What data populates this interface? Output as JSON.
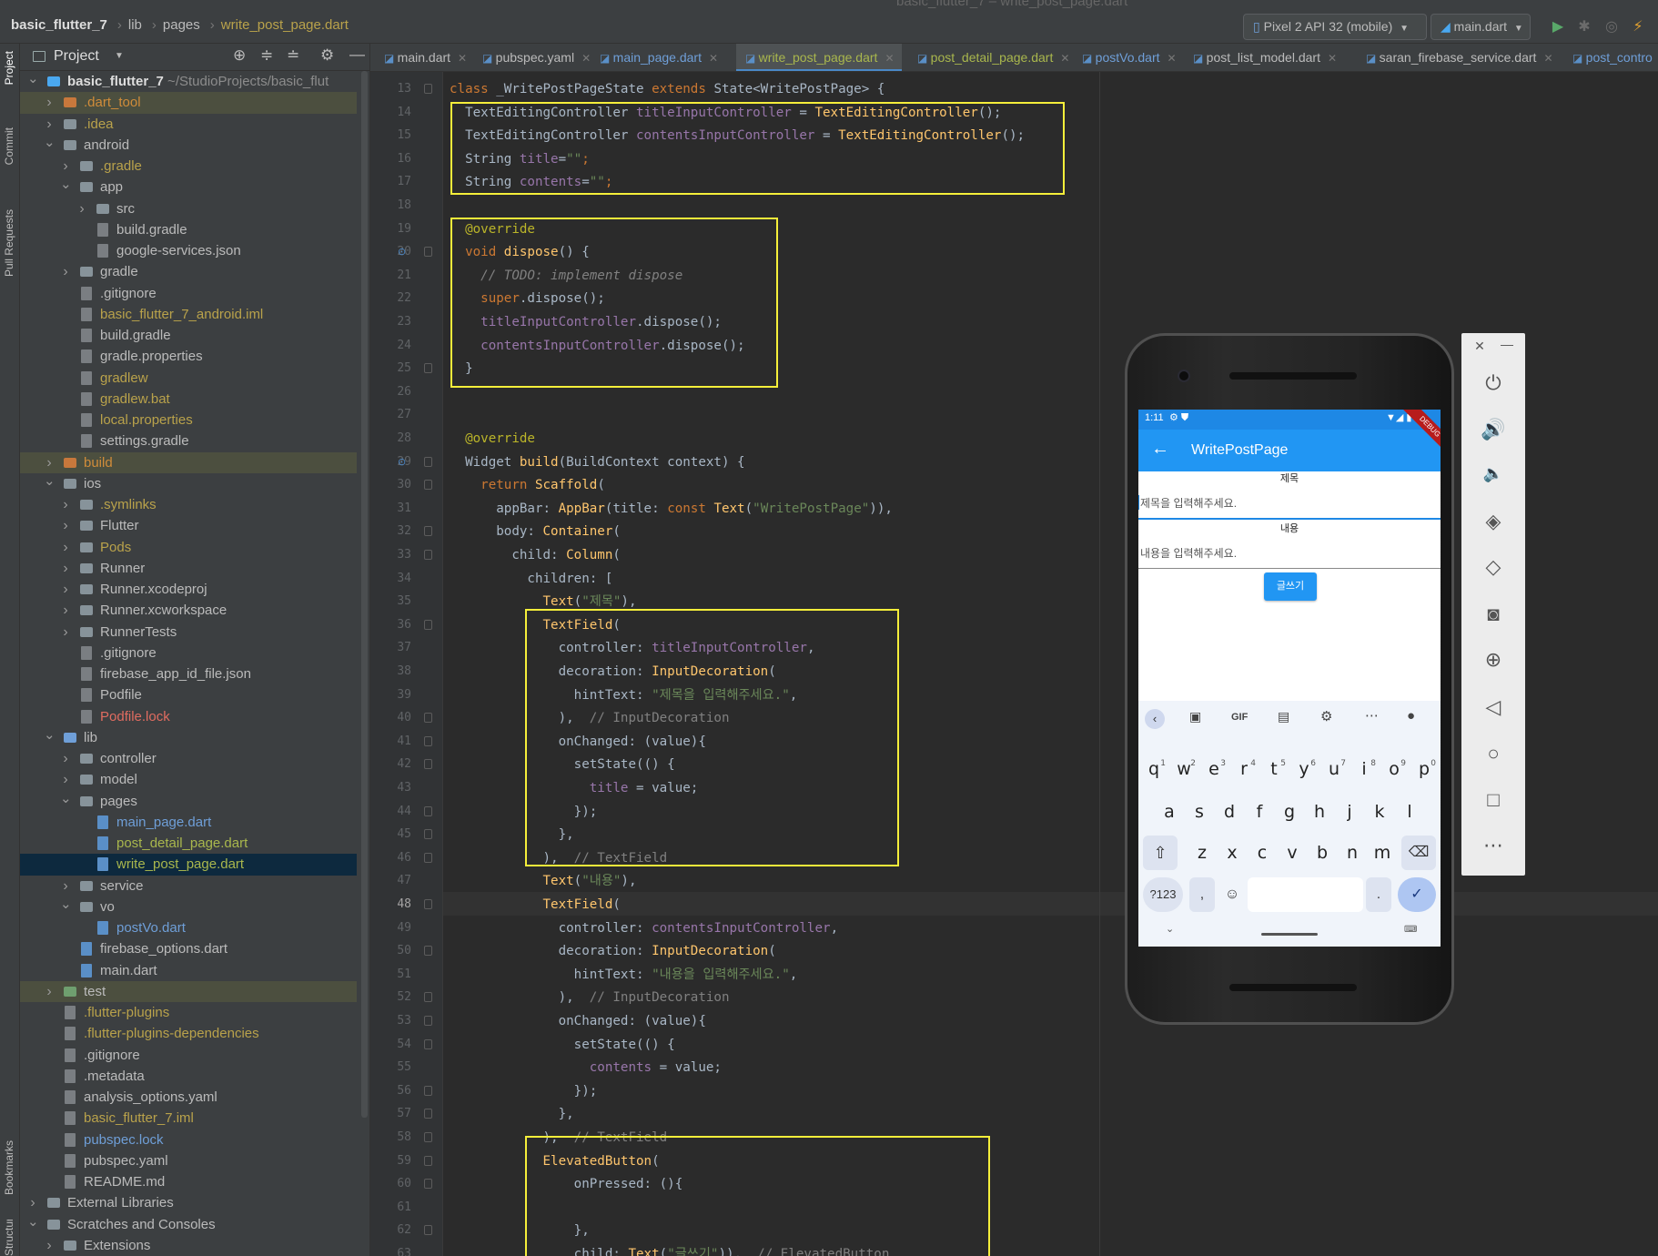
{
  "window": {
    "title": "basic_flutter_7 – write_post_page.dart"
  },
  "breadcrumb": [
    "basic_flutter_7",
    "lib",
    "pages",
    "write_post_page.dart"
  ],
  "toolbar": {
    "device": "Pixel 2 API 32 (mobile)",
    "run_config": "main.dart"
  },
  "left_stripe": [
    "Project",
    "Commit",
    "Pull Requests",
    "Bookmarks",
    "Structure"
  ],
  "project_panel": {
    "title": "Project"
  },
  "tree": [
    {
      "label": "basic_flutter_7",
      "suffix": " ~/StudioProjects/basic_flut",
      "level": 0,
      "arrow": "down",
      "kind": "root",
      "color": "bold"
    },
    {
      "label": ".dart_tool",
      "level": 1,
      "arrow": "right",
      "kind": "folder-ex",
      "color": "excl",
      "hl": true
    },
    {
      "label": ".idea",
      "level": 1,
      "arrow": "right",
      "kind": "folder",
      "color": "yel"
    },
    {
      "label": "android",
      "level": 1,
      "arrow": "down",
      "kind": "folder"
    },
    {
      "label": ".gradle",
      "level": 2,
      "arrow": "right",
      "kind": "folder",
      "color": "yel"
    },
    {
      "label": "app",
      "level": 2,
      "arrow": "down",
      "kind": "folder"
    },
    {
      "label": "src",
      "level": 3,
      "arrow": "right",
      "kind": "folder"
    },
    {
      "label": "build.gradle",
      "level": 3,
      "kind": "file"
    },
    {
      "label": "google-services.json",
      "level": 3,
      "kind": "file"
    },
    {
      "label": "gradle",
      "level": 2,
      "arrow": "right",
      "kind": "folder"
    },
    {
      "label": ".gitignore",
      "level": 2,
      "kind": "file"
    },
    {
      "label": "basic_flutter_7_android.iml",
      "level": 2,
      "kind": "file",
      "color": "yel"
    },
    {
      "label": "build.gradle",
      "level": 2,
      "kind": "file"
    },
    {
      "label": "gradle.properties",
      "level": 2,
      "kind": "file"
    },
    {
      "label": "gradlew",
      "level": 2,
      "kind": "file",
      "color": "yel"
    },
    {
      "label": "gradlew.bat",
      "level": 2,
      "kind": "file",
      "color": "yel"
    },
    {
      "label": "local.properties",
      "level": 2,
      "kind": "file",
      "color": "yel"
    },
    {
      "label": "settings.gradle",
      "level": 2,
      "kind": "file"
    },
    {
      "label": "build",
      "level": 1,
      "arrow": "right",
      "kind": "folder-ex",
      "color": "excl",
      "hl": true
    },
    {
      "label": "ios",
      "level": 1,
      "arrow": "down",
      "kind": "folder"
    },
    {
      "label": ".symlinks",
      "level": 2,
      "arrow": "right",
      "kind": "folder",
      "color": "yel"
    },
    {
      "label": "Flutter",
      "level": 2,
      "arrow": "right",
      "kind": "folder"
    },
    {
      "label": "Pods",
      "level": 2,
      "arrow": "right",
      "kind": "folder",
      "color": "yel"
    },
    {
      "label": "Runner",
      "level": 2,
      "arrow": "right",
      "kind": "folder"
    },
    {
      "label": "Runner.xcodeproj",
      "level": 2,
      "arrow": "right",
      "kind": "folder"
    },
    {
      "label": "Runner.xcworkspace",
      "level": 2,
      "arrow": "right",
      "kind": "folder"
    },
    {
      "label": "RunnerTests",
      "level": 2,
      "arrow": "right",
      "kind": "folder"
    },
    {
      "label": ".gitignore",
      "level": 2,
      "kind": "file"
    },
    {
      "label": "firebase_app_id_file.json",
      "level": 2,
      "kind": "file"
    },
    {
      "label": "Podfile",
      "level": 2,
      "kind": "file"
    },
    {
      "label": "Podfile.lock",
      "level": 2,
      "kind": "file",
      "color": "red"
    },
    {
      "label": "lib",
      "level": 1,
      "arrow": "down",
      "kind": "folder-src"
    },
    {
      "label": "controller",
      "level": 2,
      "arrow": "right",
      "kind": "folder"
    },
    {
      "label": "model",
      "level": 2,
      "arrow": "right",
      "kind": "folder"
    },
    {
      "label": "pages",
      "level": 2,
      "arrow": "down",
      "kind": "folder"
    },
    {
      "label": "main_page.dart",
      "level": 3,
      "kind": "dart",
      "color": "blue"
    },
    {
      "label": "post_detail_page.dart",
      "level": 3,
      "kind": "dart",
      "color": "grn"
    },
    {
      "label": "write_post_page.dart",
      "level": 3,
      "kind": "dart",
      "color": "grn",
      "sel": true
    },
    {
      "label": "service",
      "level": 2,
      "arrow": "right",
      "kind": "folder"
    },
    {
      "label": "vo",
      "level": 2,
      "arrow": "down",
      "kind": "folder"
    },
    {
      "label": "postVo.dart",
      "level": 3,
      "kind": "dart",
      "color": "blue"
    },
    {
      "label": "firebase_options.dart",
      "level": 2,
      "kind": "dart"
    },
    {
      "label": "main.dart",
      "level": 2,
      "kind": "dart"
    },
    {
      "label": "test",
      "level": 1,
      "arrow": "right",
      "kind": "folder-test",
      "hl": true
    },
    {
      "label": ".flutter-plugins",
      "level": 1,
      "kind": "file",
      "color": "yel"
    },
    {
      "label": ".flutter-plugins-dependencies",
      "level": 1,
      "kind": "file",
      "color": "yel"
    },
    {
      "label": ".gitignore",
      "level": 1,
      "kind": "file"
    },
    {
      "label": ".metadata",
      "level": 1,
      "kind": "file"
    },
    {
      "label": "analysis_options.yaml",
      "level": 1,
      "kind": "file"
    },
    {
      "label": "basic_flutter_7.iml",
      "level": 1,
      "kind": "file",
      "color": "yel"
    },
    {
      "label": "pubspec.lock",
      "level": 1,
      "kind": "file",
      "color": "blue"
    },
    {
      "label": "pubspec.yaml",
      "level": 1,
      "kind": "file"
    },
    {
      "label": "README.md",
      "level": 1,
      "kind": "file"
    },
    {
      "label": "External Libraries",
      "level": 0,
      "arrow": "right",
      "kind": "lib"
    },
    {
      "label": "Scratches and Consoles",
      "level": 0,
      "arrow": "down",
      "kind": "scratch"
    },
    {
      "label": "Extensions",
      "level": 1,
      "arrow": "right",
      "kind": "folder"
    }
  ],
  "tabs": [
    {
      "label": "main.dart",
      "x": 0
    },
    {
      "label": "pubspec.yaml",
      "x": 0
    },
    {
      "label": "main_page.dart",
      "x": 0,
      "color": "blue"
    },
    {
      "label": "write_post_page.dart",
      "x": 0,
      "color": "grn",
      "active": true
    },
    {
      "label": "post_detail_page.dart",
      "x": 0,
      "color": "grn"
    },
    {
      "label": "postVo.dart",
      "x": 0,
      "color": "blue"
    },
    {
      "label": "post_list_model.dart",
      "x": 0
    },
    {
      "label": "saran_firebase_service.dart",
      "x": 0
    },
    {
      "label": "post_contro",
      "x": 0,
      "color": "blue"
    }
  ],
  "editor": {
    "first_line": 13,
    "current_line": 48,
    "lines": [
      [
        [
          "kw",
          "class "
        ],
        [
          "ty",
          "_WritePostPageState "
        ],
        [
          "kw",
          "extends "
        ],
        [
          "ty",
          "State<WritePostPage> {"
        ]
      ],
      [
        [
          "ty",
          "  TextEditingController "
        ],
        [
          "fd",
          "titleInputController"
        ],
        [
          "ty",
          " = "
        ],
        [
          "fn",
          "TextEditingController"
        ],
        [
          "ty",
          "();"
        ]
      ],
      [
        [
          "ty",
          "  TextEditingController "
        ],
        [
          "fd",
          "contentsInputController"
        ],
        [
          "ty",
          " = "
        ],
        [
          "fn",
          "TextEditingController"
        ],
        [
          "ty",
          "();"
        ]
      ],
      [
        [
          "ty",
          "  String "
        ],
        [
          "fd",
          "title"
        ],
        [
          "ty",
          "="
        ],
        [
          "st",
          "\"\""
        ],
        [
          "kw",
          ";"
        ]
      ],
      [
        [
          "ty",
          "  String "
        ],
        [
          "fd",
          "contents"
        ],
        [
          "ty",
          "="
        ],
        [
          "st",
          "\"\""
        ],
        [
          "kw",
          ";"
        ]
      ],
      [
        [
          "ty",
          ""
        ]
      ],
      [
        [
          "an",
          "  @override"
        ]
      ],
      [
        [
          "kw",
          "  void "
        ],
        [
          "fn",
          "dispose"
        ],
        [
          "ty",
          "() {"
        ]
      ],
      [
        [
          "cm",
          "    // TODO: implement dispose"
        ]
      ],
      [
        [
          "kw",
          "    super"
        ],
        [
          "ty",
          ".dispose();"
        ]
      ],
      [
        [
          "fd",
          "    titleInputController"
        ],
        [
          "ty",
          ".dispose();"
        ]
      ],
      [
        [
          "fd",
          "    contentsInputController"
        ],
        [
          "ty",
          ".dispose();"
        ]
      ],
      [
        [
          "ty",
          "  }"
        ]
      ],
      [
        [
          "ty",
          ""
        ]
      ],
      [
        [
          "ty",
          ""
        ]
      ],
      [
        [
          "an",
          "  @override"
        ]
      ],
      [
        [
          "ty",
          "  Widget "
        ],
        [
          "fn",
          "build"
        ],
        [
          "ty",
          "(BuildContext context) {"
        ]
      ],
      [
        [
          "kw",
          "    return "
        ],
        [
          "fn",
          "Scaffold"
        ],
        [
          "ty",
          "("
        ]
      ],
      [
        [
          "ty",
          "      appBar: "
        ],
        [
          "fn",
          "AppBar"
        ],
        [
          "ty",
          "(title: "
        ],
        [
          "kw",
          "const "
        ],
        [
          "fn",
          "Text"
        ],
        [
          "ty",
          "("
        ],
        [
          "st",
          "\"WritePostPage\""
        ],
        [
          "ty",
          ")),"
        ]
      ],
      [
        [
          "ty",
          "      body: "
        ],
        [
          "fn",
          "Container"
        ],
        [
          "ty",
          "("
        ]
      ],
      [
        [
          "ty",
          "        child: "
        ],
        [
          "fn",
          "Column"
        ],
        [
          "ty",
          "("
        ]
      ],
      [
        [
          "ty",
          "          children: ["
        ]
      ],
      [
        [
          "fn",
          "            Text"
        ],
        [
          "ty",
          "("
        ],
        [
          "st",
          "\"제목\""
        ],
        [
          "ty",
          "),"
        ]
      ],
      [
        [
          "fn",
          "            TextField"
        ],
        [
          "ty",
          "("
        ]
      ],
      [
        [
          "ty",
          "              controller: "
        ],
        [
          "fd",
          "titleInputController"
        ],
        [
          "ty",
          ","
        ]
      ],
      [
        [
          "ty",
          "              decoration: "
        ],
        [
          "fn",
          "InputDecoration"
        ],
        [
          "ty",
          "("
        ]
      ],
      [
        [
          "ty",
          "                hintText: "
        ],
        [
          "st",
          "\"제목을 입력해주세요.\""
        ],
        [
          "ty",
          ","
        ]
      ],
      [
        [
          "ty",
          "              ),  "
        ],
        [
          "cmt",
          "// InputDecoration"
        ]
      ],
      [
        [
          "ty",
          "              onChanged: (value){"
        ]
      ],
      [
        [
          "ty",
          "                setState(() {"
        ]
      ],
      [
        [
          "fd",
          "                  title"
        ],
        [
          "ty",
          " = value;"
        ]
      ],
      [
        [
          "ty",
          "                });"
        ]
      ],
      [
        [
          "ty",
          "              },"
        ]
      ],
      [
        [
          "ty",
          "            ),  "
        ],
        [
          "cmt",
          "// TextField"
        ]
      ],
      [
        [
          "fn",
          "            Text"
        ],
        [
          "ty",
          "("
        ],
        [
          "st",
          "\"내용\""
        ],
        [
          "ty",
          "),"
        ]
      ],
      [
        [
          "fn",
          "            TextField"
        ],
        [
          "ty",
          "("
        ]
      ],
      [
        [
          "ty",
          "              controller: "
        ],
        [
          "fd",
          "contentsInputController"
        ],
        [
          "ty",
          ","
        ]
      ],
      [
        [
          "ty",
          "              decoration: "
        ],
        [
          "fn",
          "InputDecoration"
        ],
        [
          "ty",
          "("
        ]
      ],
      [
        [
          "ty",
          "                hintText: "
        ],
        [
          "st",
          "\"내용을 입력해주세요.\""
        ],
        [
          "ty",
          ","
        ]
      ],
      [
        [
          "ty",
          "              ),  "
        ],
        [
          "cmt",
          "// InputDecoration"
        ]
      ],
      [
        [
          "ty",
          "              onChanged: (value){"
        ]
      ],
      [
        [
          "ty",
          "                setState(() {"
        ]
      ],
      [
        [
          "fd",
          "                  contents"
        ],
        [
          "ty",
          " = value;"
        ]
      ],
      [
        [
          "ty",
          "                });"
        ]
      ],
      [
        [
          "ty",
          "              },"
        ]
      ],
      [
        [
          "ty",
          "            ),  "
        ],
        [
          "cmt",
          "// TextField"
        ]
      ],
      [
        [
          "fn",
          "            ElevatedButton"
        ],
        [
          "ty",
          "("
        ]
      ],
      [
        [
          "ty",
          "                onPressed: (){"
        ]
      ],
      [
        [
          "ty",
          ""
        ]
      ],
      [
        [
          "ty",
          "                },"
        ]
      ],
      [
        [
          "ty",
          "                child: "
        ],
        [
          "fn",
          "Text"
        ],
        [
          "ty",
          "("
        ],
        [
          "st",
          "\"글쓰기\""
        ],
        [
          "ty",
          ")),  "
        ],
        [
          "cmt",
          "// ElevatedButton"
        ]
      ]
    ]
  },
  "phone": {
    "status_time": "1:11",
    "debug_banner": "DEBUG",
    "appbar_title": "WritePostPage",
    "label_title": "제목",
    "hint_title": "제목을 입력해주세요.",
    "label_contents": "내용",
    "hint_contents": "내용을 입력해주세요.",
    "button_label": "글쓰기",
    "kb_gif": "GIF",
    "kb_row1": [
      "q",
      "w",
      "e",
      "r",
      "t",
      "y",
      "u",
      "i",
      "o",
      "p"
    ],
    "kb_row1_sup": [
      "1",
      "2",
      "3",
      "4",
      "5",
      "6",
      "7",
      "8",
      "9",
      "0"
    ],
    "kb_row2": [
      "a",
      "s",
      "d",
      "f",
      "g",
      "h",
      "j",
      "k",
      "l"
    ],
    "kb_row3": [
      "z",
      "x",
      "c",
      "v",
      "b",
      "n",
      "m"
    ],
    "kb_sym": "?123",
    "kb_comma": ",",
    "kb_period": "."
  },
  "emulator_controls": [
    "close",
    "minimize",
    "power",
    "volume-up",
    "volume-down",
    "rotate-left",
    "rotate-right",
    "screenshot",
    "zoom",
    "back",
    "home",
    "overview",
    "more"
  ],
  "colors": {
    "highlight_box": "#f5ee3a",
    "accent": "#4a88c7",
    "appbar": "#2196f3"
  }
}
